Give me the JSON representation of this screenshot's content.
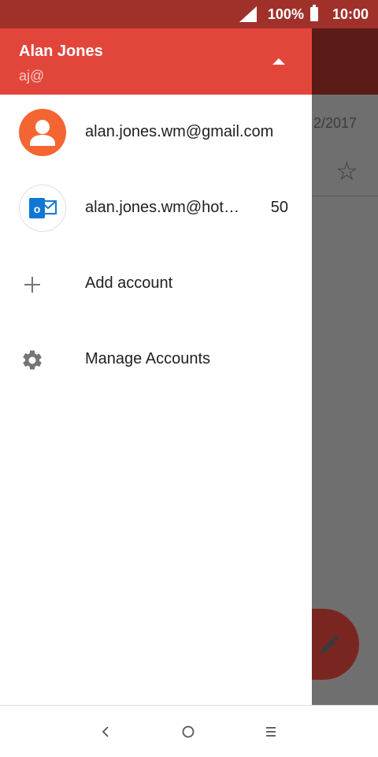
{
  "status_bar": {
    "battery_percent": "100%",
    "time": "10:00",
    "icons": [
      "signal-icon",
      "battery-icon"
    ]
  },
  "drawer": {
    "header": {
      "name": "Alan Jones",
      "email": "aj@",
      "toggle_icon": "caret-up-icon"
    },
    "accounts": [
      {
        "email": "alan.jones.wm@gmail.com",
        "icon": "person-avatar-icon",
        "count": ""
      },
      {
        "email": "alan.jones.wm@hot…",
        "icon": "outlook-icon",
        "count": "50"
      }
    ],
    "menu": [
      {
        "label": "Add account",
        "icon": "plus-icon"
      },
      {
        "label": "Manage Accounts",
        "icon": "gear-icon"
      }
    ]
  },
  "background_app": {
    "date_fragment": "2/2017",
    "star_icon": "star-outline-icon",
    "fab_icon": "pencil-icon"
  },
  "nav_bar": {
    "buttons": [
      "back-icon",
      "home-icon",
      "recents-icon"
    ]
  },
  "colors": {
    "header": "#e2463b",
    "status_bar": "#a0312a",
    "gmail_avatar": "#f46534",
    "outlook_blue": "#0f78d4"
  }
}
